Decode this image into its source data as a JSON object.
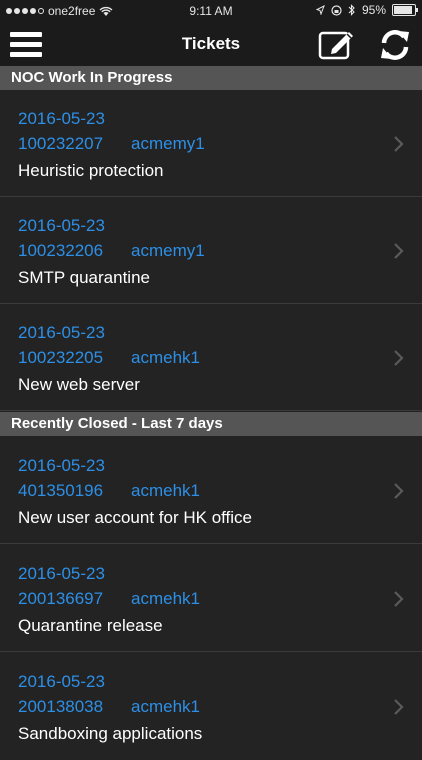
{
  "status_bar": {
    "carrier": "one2free",
    "time": "9:11 AM",
    "battery": "95%"
  },
  "nav": {
    "title": "Tickets",
    "menu_icon": "hamburger-menu-icon",
    "compose_icon": "compose-icon",
    "refresh_icon": "refresh-icon"
  },
  "sections": [
    {
      "title": "NOC Work In Progress",
      "tickets": [
        {
          "date": "2016-05-23",
          "number": "100232207",
          "user": "acmemy1",
          "title": "Heuristic protection"
        },
        {
          "date": "2016-05-23",
          "number": "100232206",
          "user": "acmemy1",
          "title": "SMTP quarantine"
        },
        {
          "date": "2016-05-23",
          "number": "100232205",
          "user": "acmehk1",
          "title": "New web server"
        }
      ]
    },
    {
      "title": "Recently Closed - Last 7 days",
      "tickets": [
        {
          "date": "2016-05-23",
          "number": "401350196",
          "user": "acmehk1",
          "title": "New user account for HK office"
        },
        {
          "date": "2016-05-23",
          "number": "200136697",
          "user": "acmehk1",
          "title": "Quarantine release"
        },
        {
          "date": "2016-05-23",
          "number": "200138038",
          "user": "acmehk1",
          "title": "Sandboxing applications"
        }
      ]
    }
  ],
  "colors": {
    "accent": "#2d8fe6",
    "background": "#232323",
    "section_header": "#555555"
  }
}
